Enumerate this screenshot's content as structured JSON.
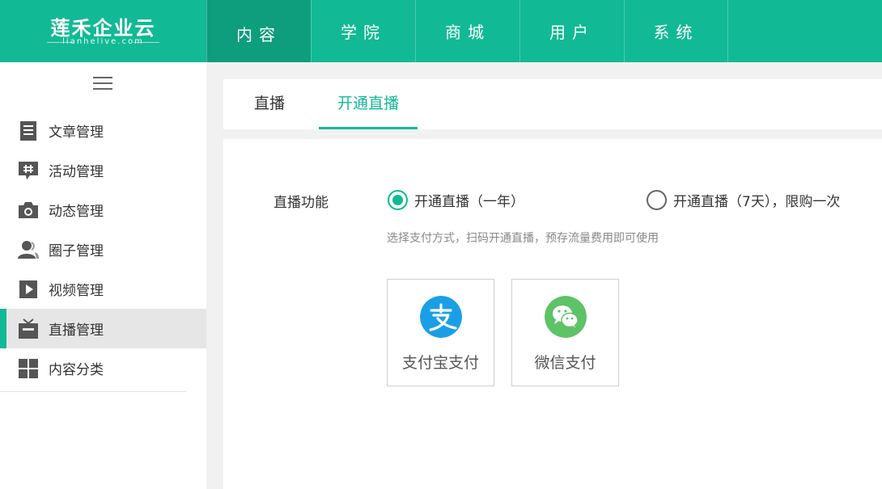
{
  "brand": {
    "title": "莲禾企业云",
    "subtitle": "lianhelive.com"
  },
  "topnav": [
    {
      "label": "内容",
      "active": true
    },
    {
      "label": "学院",
      "active": false
    },
    {
      "label": "商城",
      "active": false
    },
    {
      "label": "用户",
      "active": false
    },
    {
      "label": "系统",
      "active": false
    }
  ],
  "sidebar": {
    "items": [
      {
        "label": "文章管理",
        "icon": "document-icon"
      },
      {
        "label": "活动管理",
        "icon": "hashtag-chat-icon"
      },
      {
        "label": "动态管理",
        "icon": "camera-icon"
      },
      {
        "label": "圈子管理",
        "icon": "users-icon"
      },
      {
        "label": "视频管理",
        "icon": "video-play-icon"
      },
      {
        "label": "直播管理",
        "icon": "tv-icon",
        "active": true
      },
      {
        "label": "内容分类",
        "icon": "grid-icon"
      }
    ]
  },
  "tabs": [
    {
      "label": "直播",
      "active": false
    },
    {
      "label": "开通直播",
      "active": true
    }
  ],
  "form": {
    "label": "直播功能",
    "options": [
      {
        "label": "开通直播（一年）",
        "checked": true
      },
      {
        "label": "开通直播（7天），限购一次",
        "checked": false
      }
    ],
    "hint": "选择支付方式，扫码开通直播，预存流量费用即可使用",
    "payments": [
      {
        "label": "支付宝支付",
        "icon": "alipay-icon",
        "color": "#1a9fe6"
      },
      {
        "label": "微信支付",
        "icon": "wechat-icon",
        "color": "#5ec267"
      }
    ]
  },
  "colors": {
    "accent": "#12b995",
    "accent_dark": "#0e9d7d"
  }
}
